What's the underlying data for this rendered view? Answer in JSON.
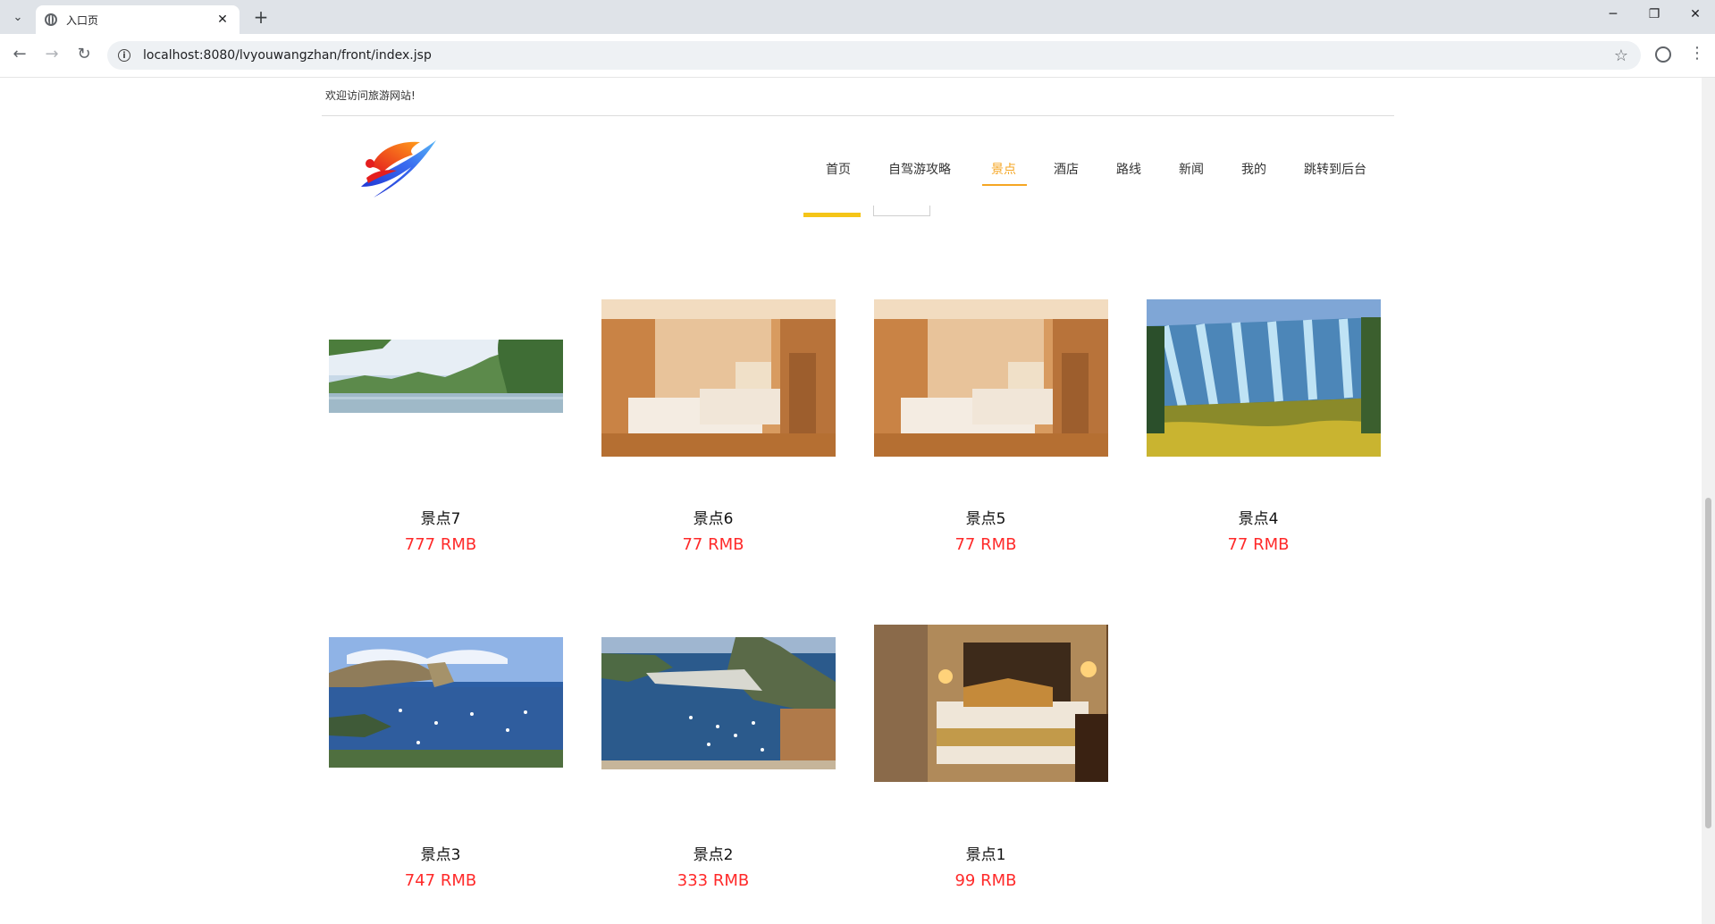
{
  "browser": {
    "tab_title": "入口页",
    "tab_close": "✕",
    "new_tab": "+",
    "url": "localhost:8080/lvyouwangzhan/front/index.jsp",
    "controls": {
      "minimize": "─",
      "restore": "❐",
      "close": "✕"
    },
    "nav": {
      "back": "←",
      "forward": "→",
      "reload": "↻"
    }
  },
  "header": {
    "welcome": "欢迎访问旅游网站!"
  },
  "nav": {
    "items": [
      {
        "label": "首页",
        "active": false
      },
      {
        "label": "自驾游攻略",
        "active": false
      },
      {
        "label": "景点",
        "active": true
      },
      {
        "label": "酒店",
        "active": false
      },
      {
        "label": "路线",
        "active": false
      },
      {
        "label": "新闻",
        "active": false
      },
      {
        "label": "我的",
        "active": false
      },
      {
        "label": "跳转到后台",
        "active": false
      }
    ]
  },
  "attractions": [
    {
      "name": "景点7",
      "price": "777 RMB",
      "image": "river-landscape"
    },
    {
      "name": "景点6",
      "price": "77 RMB",
      "image": "hotel-room-twin"
    },
    {
      "name": "景点5",
      "price": "77 RMB",
      "image": "hotel-room-twin"
    },
    {
      "name": "景点4",
      "price": "77 RMB",
      "image": "waterfall"
    },
    {
      "name": "景点3",
      "price": "747 RMB",
      "image": "coast-birds"
    },
    {
      "name": "景点2",
      "price": "333 RMB",
      "image": "bay-harbor"
    },
    {
      "name": "景点1",
      "price": "99 RMB",
      "image": "hotel-room-luxury"
    }
  ],
  "colors": {
    "accent": "#f5a623",
    "price": "#ff2a2a"
  }
}
